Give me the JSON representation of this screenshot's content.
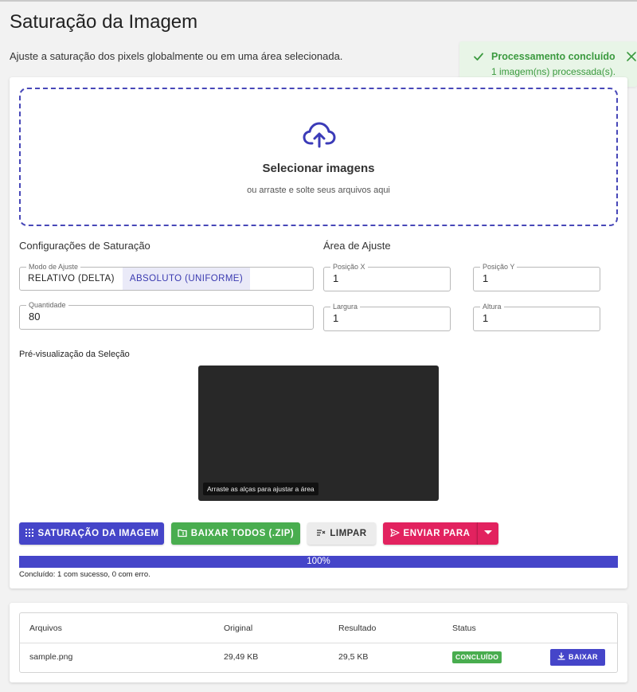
{
  "header": {
    "title": "Saturação da Imagem",
    "subtitle": "Ajuste a saturação dos pixels globalmente ou em uma área selecionada."
  },
  "toast": {
    "title": "Processamento concluído",
    "message": "1 imagem(ns) processada(s).",
    "color": "#3b9a3f"
  },
  "dropzone": {
    "title": "Selecionar imagens",
    "subtitle": "ou arraste e solte seus arquivos aqui",
    "icon": "cloud-upload-icon"
  },
  "settings": {
    "title": "Configurações de Saturação",
    "mode_label": "Modo de Ajuste",
    "mode_options": [
      "RELATIVO (DELTA)",
      "ABSOLUTO (UNIFORME)"
    ],
    "mode_selected": "ABSOLUTO (UNIFORME)",
    "quantity_label": "Quantidade",
    "quantity_value": "80"
  },
  "area": {
    "title": "Área de Ajuste",
    "x_label": "Posição X",
    "x_value": "1",
    "y_label": "Posição Y",
    "y_value": "1",
    "width_label": "Largura",
    "width_value": "1",
    "height_label": "Altura",
    "height_value": "1"
  },
  "preview": {
    "title": "Pré-visualização da Seleção",
    "hint": "Arraste as alças para ajustar a área"
  },
  "actions": {
    "saturate": "SATURAÇÃO DA IMAGEM",
    "download_all": "BAIXAR TODOS (.ZIP)",
    "clear": "LIMPAR",
    "send_to": "ENVIAR PARA"
  },
  "progress": {
    "percent": 100,
    "label": "100%",
    "message": "Concluído: 1 com sucesso, 0 com erro."
  },
  "table": {
    "headers": [
      "Arquivos",
      "Original",
      "Resultado",
      "Status"
    ],
    "rows": [
      {
        "file": "sample.png",
        "original": "29,49 KB",
        "result": "29,5 KB",
        "status": "CONCLUÍDO",
        "action": "BAIXAR"
      }
    ]
  },
  "colors": {
    "primary": "#4545c9",
    "success": "#49ad4f",
    "accent": "#e2225f"
  }
}
